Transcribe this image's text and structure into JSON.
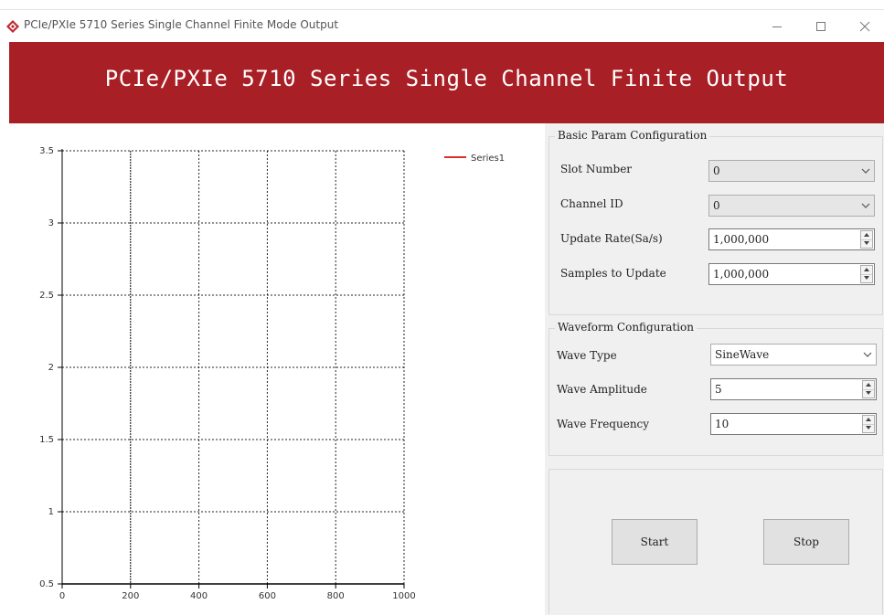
{
  "window": {
    "title": "PCIe/PXIe 5710 Series Single Channel Finite Mode Output",
    "controls": [
      "minimize",
      "maximize",
      "close"
    ]
  },
  "banner": {
    "title": "PCIe/PXIe 5710 Series Single Channel Finite Output",
    "color": "#a91f26"
  },
  "chart_data": {
    "type": "line",
    "title": "",
    "xlabel": "",
    "ylabel": "",
    "xlim": [
      0,
      1000
    ],
    "ylim": [
      0.5,
      3.5
    ],
    "x_ticks": [
      "0",
      "200",
      "400",
      "600",
      "800",
      "1000"
    ],
    "y_ticks": [
      "0.5",
      "1",
      "1.5",
      "2",
      "2.5",
      "3",
      "3.5"
    ],
    "grid": true,
    "legend_position": "top-right",
    "series": [
      {
        "name": "Series1",
        "color": "#d9322b",
        "x": [],
        "y": []
      }
    ]
  },
  "basic_config": {
    "legend": "Basic Param Configuration",
    "slot_number": {
      "label": "Slot Number",
      "value": "0"
    },
    "channel_id": {
      "label": "Channel ID",
      "value": "0"
    },
    "update_rate": {
      "label": "Update Rate(Sa/s)",
      "value": "1,000,000"
    },
    "samples_to_update": {
      "label": "Samples to Update",
      "value": "1,000,000"
    }
  },
  "waveform_config": {
    "legend": "Waveform Configuration",
    "wave_type": {
      "label": "Wave Type",
      "value": "SineWave"
    },
    "wave_amplitude": {
      "label": "Wave Amplitude",
      "value": "5"
    },
    "wave_frequency": {
      "label": "Wave Frequency",
      "value": "10"
    }
  },
  "actions": {
    "start_label": "Start",
    "stop_label": "Stop"
  }
}
